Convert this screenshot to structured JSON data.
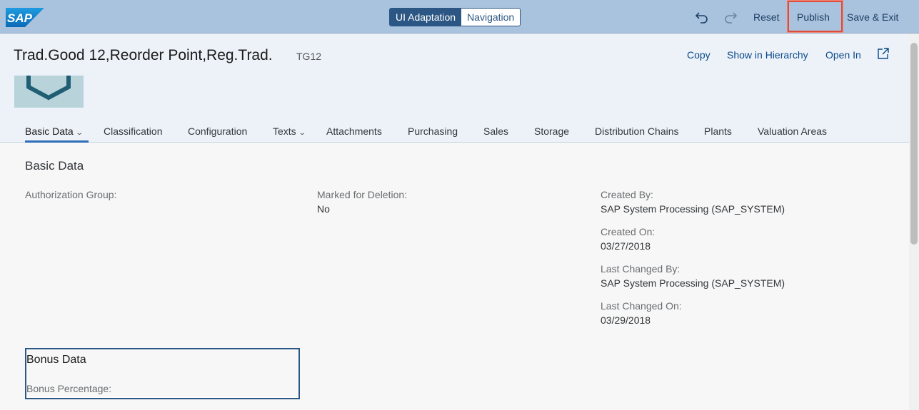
{
  "toolbar": {
    "logo_text": "SAP",
    "mode_ui_adaptation": "UI Adaptation",
    "mode_navigation": "Navigation",
    "undo_icon": "undo-icon",
    "redo_icon": "redo-icon",
    "reset_label": "Reset",
    "publish_label": "Publish",
    "save_exit_label": "Save & Exit",
    "highlight_color": "#e04b3a"
  },
  "header": {
    "title": "Trad.Good 12,Reorder Point,Reg.Trad.",
    "subtitle": "TG12",
    "actions": {
      "copy": "Copy",
      "show_in_hierarchy": "Show in Hierarchy",
      "open_in": "Open In",
      "share_icon": "share-icon"
    }
  },
  "tabs": [
    {
      "label": "Basic Data",
      "has_menu": true,
      "selected": true
    },
    {
      "label": "Classification"
    },
    {
      "label": "Configuration"
    },
    {
      "label": "Texts",
      "has_menu": true
    },
    {
      "label": "Attachments"
    },
    {
      "label": "Purchasing"
    },
    {
      "label": "Sales"
    },
    {
      "label": "Storage"
    },
    {
      "label": "Distribution Chains"
    },
    {
      "label": "Plants"
    },
    {
      "label": "Valuation Areas"
    }
  ],
  "basic_data": {
    "section_title": "Basic Data",
    "authorization_group_label": "Authorization Group:",
    "marked_for_deletion_label": "Marked for Deletion:",
    "marked_for_deletion_value": "No",
    "created_by_label": "Created By:",
    "created_by_value": "SAP System Processing (SAP_SYSTEM)",
    "created_on_label": "Created On:",
    "created_on_value": "03/27/2018",
    "last_changed_by_label": "Last Changed By:",
    "last_changed_by_value": "SAP System Processing (SAP_SYSTEM)",
    "last_changed_on_label": "Last Changed On:",
    "last_changed_on_value": "03/29/2018"
  },
  "bonus_data": {
    "title": "Bonus Data",
    "bonus_percentage_label": "Bonus Percentage:"
  },
  "colors": {
    "toolbar_bg": "#a9c2dd",
    "accent": "#2c5784",
    "header_bg": "#edf2f9"
  }
}
